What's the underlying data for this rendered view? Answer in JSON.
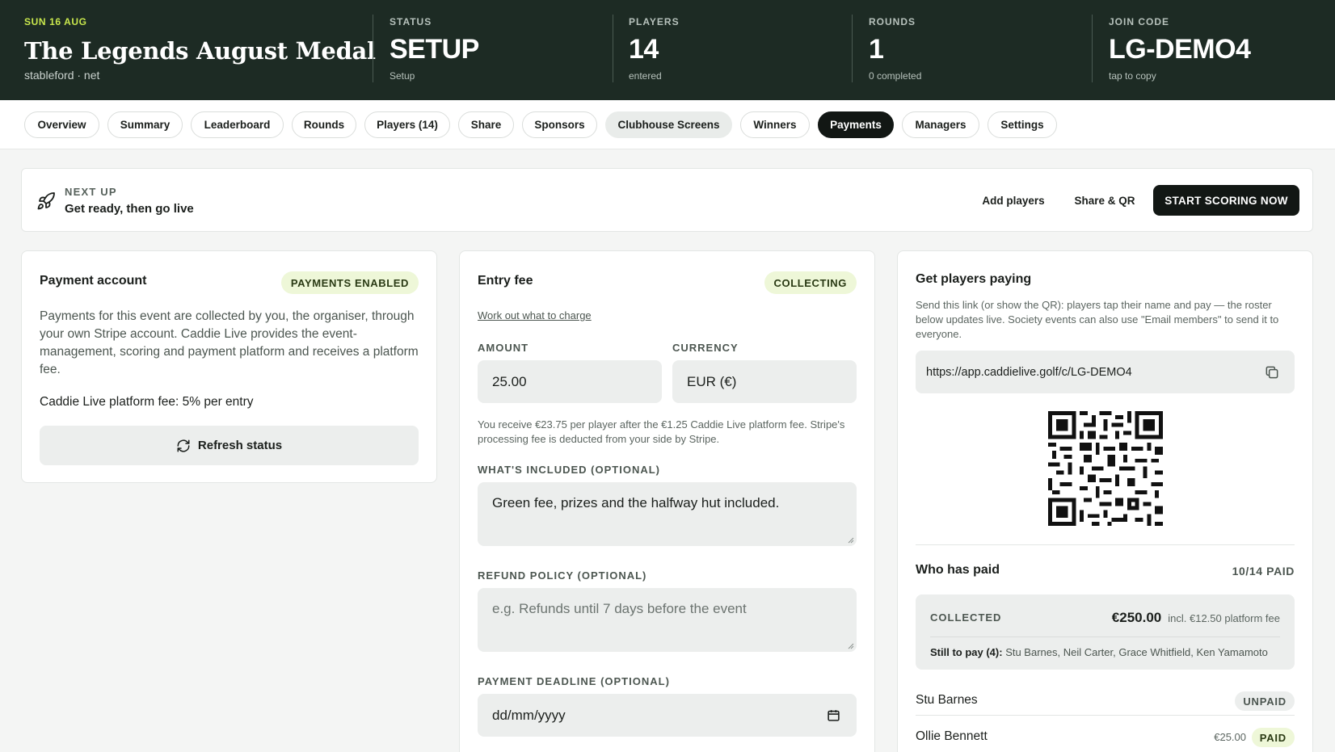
{
  "header": {
    "date": "SUN 16 AUG",
    "title": "The Legends August Medal",
    "subtitle": "stableford · net",
    "stats": [
      {
        "label": "STATUS",
        "value": "SETUP",
        "sub": "Setup"
      },
      {
        "label": "PLAYERS",
        "value": "14",
        "sub": "entered"
      },
      {
        "label": "ROUNDS",
        "value": "1",
        "sub": "0 completed"
      },
      {
        "label": "JOIN CODE",
        "value": "LG-DEMO4",
        "sub": "tap to copy"
      }
    ]
  },
  "tabs": [
    {
      "label": "Overview"
    },
    {
      "label": "Summary"
    },
    {
      "label": "Leaderboard"
    },
    {
      "label": "Rounds"
    },
    {
      "label": "Players (14)"
    },
    {
      "label": "Share"
    },
    {
      "label": "Sponsors"
    },
    {
      "label": "Clubhouse Screens"
    },
    {
      "label": "Winners"
    },
    {
      "label": "Payments"
    },
    {
      "label": "Managers"
    },
    {
      "label": "Settings"
    }
  ],
  "active_tab": "Payments",
  "next_up": {
    "kicker": "NEXT UP",
    "text": "Get ready, then go live",
    "add_players": "Add players",
    "share_qr": "Share & QR",
    "start": "START SCORING NOW"
  },
  "payment_account": {
    "title": "Payment account",
    "badge": "PAYMENTS ENABLED",
    "description": "Payments for this event are collected by you, the organiser, through your own Stripe account. Caddie Live provides the event-management, scoring and payment platform and receives a platform fee.",
    "fee_text": "Caddie Live platform fee: 5% per entry",
    "refresh_label": "Refresh status"
  },
  "entry_fee": {
    "title": "Entry fee",
    "badge": "COLLECTING",
    "work_out_link": "Work out what to charge",
    "amount_label": "AMOUNT",
    "amount_value": "25.00",
    "currency_label": "CURRENCY",
    "currency_value": "EUR (€)",
    "receive_note": "You receive €23.75 per player after the €1.25 Caddie Live platform fee. Stripe's processing fee is deducted from your side by Stripe.",
    "included_label": "WHAT'S INCLUDED (OPTIONAL)",
    "included_value": "Green fee, prizes and the halfway hut included.",
    "refund_label": "REFUND POLICY (OPTIONAL)",
    "refund_placeholder": "e.g. Refunds until 7 days before the event",
    "deadline_label": "PAYMENT DEADLINE (OPTIONAL)",
    "deadline_placeholder": "dd/mm/yyyy"
  },
  "get_paying": {
    "title": "Get players paying",
    "description": "Send this link (or show the QR): players tap their name and pay — the roster below updates live. Society events can also use \"Email members\" to send it to everyone.",
    "url": "https://app.caddielive.golf/c/LG-DEMO4",
    "who_paid_title": "Who has paid",
    "who_paid_count": "10/14 PAID",
    "collected_label": "COLLECTED",
    "collected_amount": "€250.00",
    "collected_fee": "incl. €12.50 platform fee",
    "still_label": "Still to pay (4):",
    "still_names": "Stu Barnes, Neil Carter, Grace Whitfield, Ken Yamamoto",
    "rows": [
      {
        "name": "Stu Barnes",
        "amount": "",
        "status": "UNPAID"
      },
      {
        "name": "Ollie Bennett",
        "amount": "€25.00",
        "status": "PAID"
      }
    ]
  },
  "colors": {
    "header_bg": "#1d2b24",
    "accent_lime": "#c9e84d",
    "badge_bg": "#eef7d8",
    "dark_button": "#121714"
  }
}
